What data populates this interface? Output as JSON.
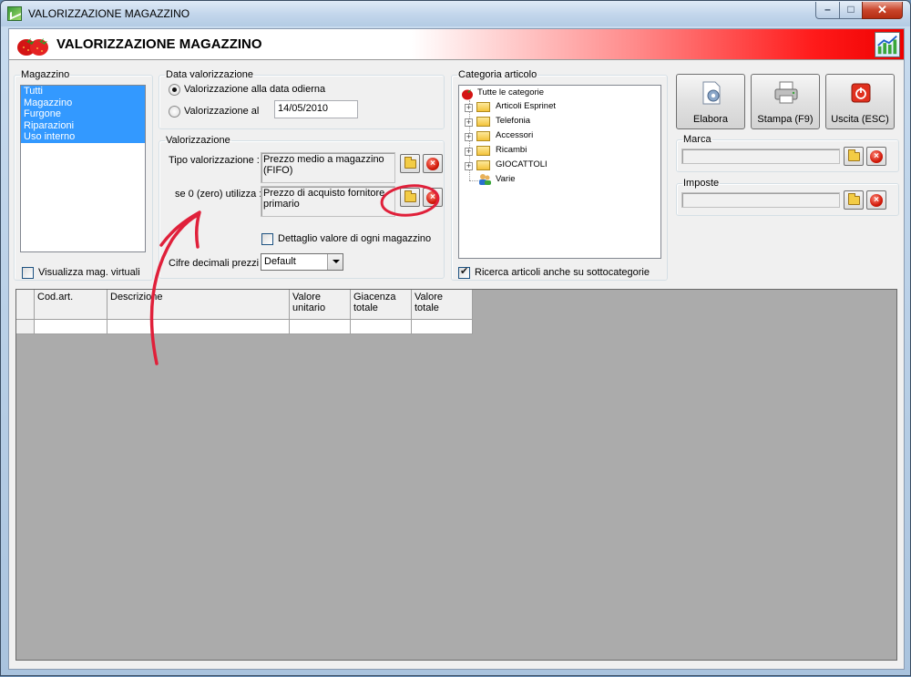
{
  "window": {
    "title": "VALORIZZAZIONE MAGAZZINO",
    "header_title": "VALORIZZAZIONE MAGAZZINO",
    "min_glyph": "–",
    "max_glyph": "□",
    "close_glyph": "✕"
  },
  "magazzino": {
    "legend": "Magazzino",
    "items": [
      "Tutti",
      "Magazzino",
      "Furgone",
      "Riparazioni",
      "Uso interno"
    ],
    "virtual_label": "Visualizza mag. virtuali",
    "virtual_checked": false
  },
  "data_valorizzazione": {
    "legend": "Data valorizzazione",
    "option_today": "Valorizzazione alla data odierna",
    "option_date": "Valorizzazione al",
    "date_value": "14/05/2010",
    "selected": "today"
  },
  "valorizzazione": {
    "legend": "Valorizzazione",
    "tipo_label": "Tipo valorizzazione :",
    "tipo_value": "Prezzo medio a magazzino (FIFO)",
    "zero_label": "se 0 (zero) utilizza :",
    "zero_value": "Prezzo di acquisto fornitore primario",
    "dettaglio_label": "Dettaglio valore di ogni magazzino",
    "dettaglio_checked": false,
    "cifre_label": "Cifre decimali prezzi :",
    "cifre_value": "Default"
  },
  "categoria": {
    "legend": "Categoria articolo",
    "root": "Tutte le categorie",
    "children": [
      "Articoli Esprinet",
      "Telefonia",
      "Accessori",
      "Ricambi",
      "GIOCATTOLI",
      "Varie"
    ],
    "ricerca_label": "Ricerca articoli anche su sottocategorie",
    "ricerca_checked": true
  },
  "toolbar": {
    "elabora": "Elabora",
    "stampa": "Stampa (F9)",
    "uscita": "Uscita (ESC)"
  },
  "marca": {
    "legend": "Marca",
    "value": ""
  },
  "imposte": {
    "legend": "Imposte",
    "value": ""
  },
  "grid": {
    "columns": [
      "Cod.art.",
      "Descrizione",
      "Valore unitario",
      "Giacenza totale",
      "Valore totale"
    ]
  },
  "colors": {
    "selection": "#3399ff",
    "header_red": "#ee0000",
    "annotation": "#e0203a",
    "grid_bg": "#ababab"
  }
}
